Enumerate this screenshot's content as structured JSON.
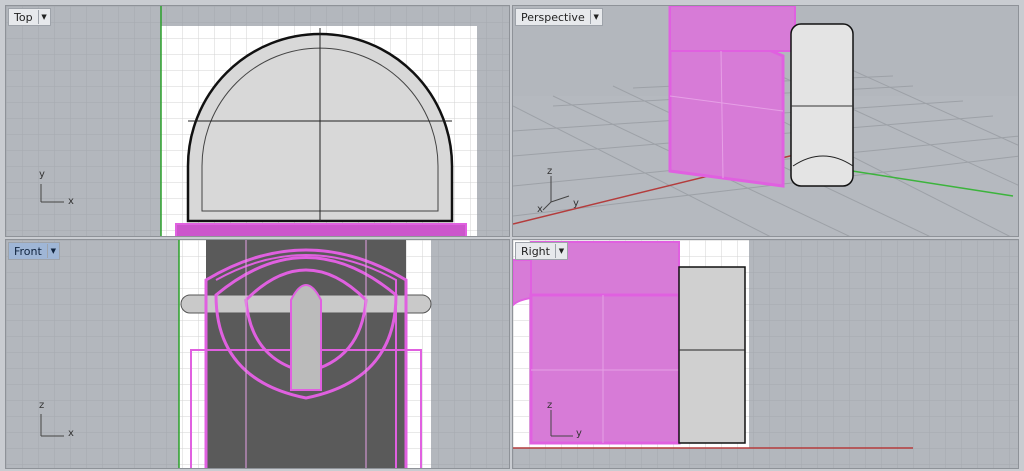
{
  "viewports": {
    "top": {
      "label": "Top",
      "axes": {
        "y": "y",
        "x": "x"
      }
    },
    "perspective": {
      "label": "Perspective",
      "axes": {
        "z": "z",
        "y": "y",
        "x": "x"
      }
    },
    "front": {
      "label": "Front",
      "axes": {
        "z": "z",
        "x": "x"
      }
    },
    "right": {
      "label": "Right",
      "axes": {
        "z": "z",
        "y": "y"
      }
    }
  },
  "active_viewport": "Front",
  "icons": {
    "dropdown": "chevron-down-icon",
    "axis": "axis-gizmo-icon"
  },
  "colors": {
    "viewport_bg": "#b3b7bd",
    "grid": "#a4a8ae",
    "highlight": "#e060e0",
    "x_axis": "#b43c3c",
    "y_axis": "#3cb43c",
    "paper": "#ffffff"
  }
}
